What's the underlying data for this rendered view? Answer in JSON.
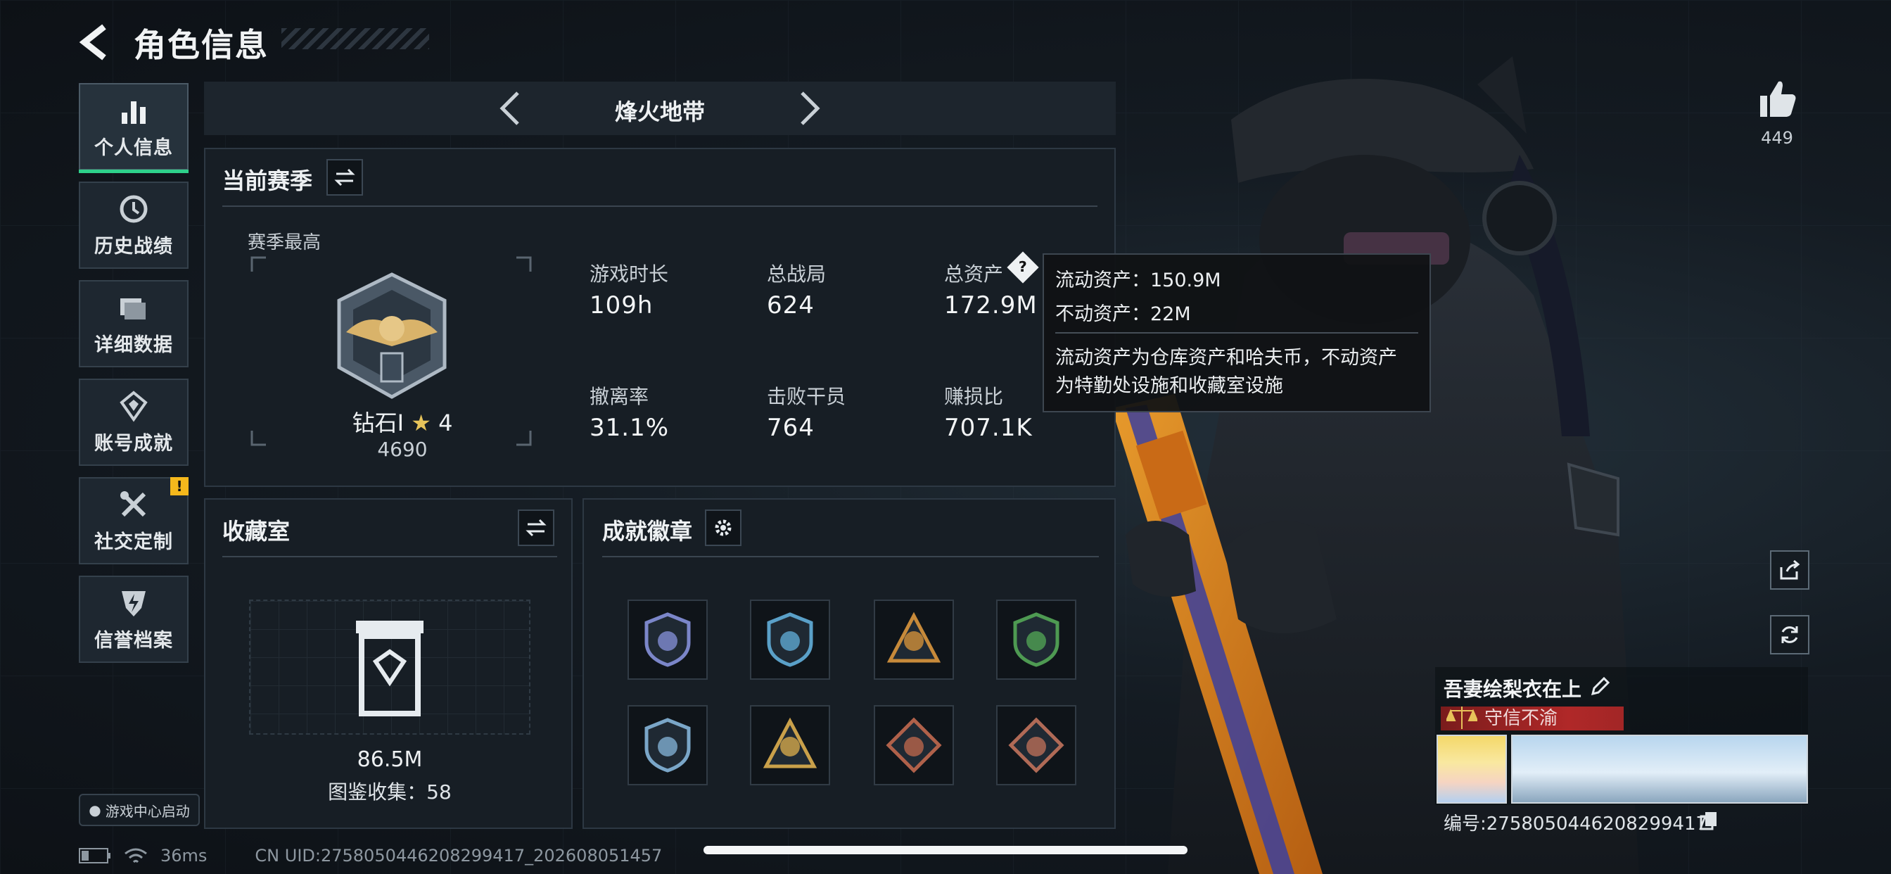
{
  "header": {
    "title": "角色信息"
  },
  "sidebar": {
    "items": [
      {
        "label": "个人信息",
        "icon": "bar-chart-icon",
        "active": true
      },
      {
        "label": "历史战绩",
        "icon": "history-icon"
      },
      {
        "label": "详细数据",
        "icon": "folder-icon"
      },
      {
        "label": "账号成就",
        "icon": "achievement-icon"
      },
      {
        "label": "社交定制",
        "icon": "wrench-icon",
        "badge": "!"
      },
      {
        "label": "信誉档案",
        "icon": "shield-bolt-icon"
      }
    ],
    "game_center": "游戏中心启动"
  },
  "mode": {
    "title": "烽火地带"
  },
  "season": {
    "title": "当前赛季",
    "best_label": "赛季最高",
    "rank_name": "钻石I",
    "rank_stars": "4",
    "rank_score": "4690",
    "stats": [
      {
        "label": "游戏时长",
        "value": "109h"
      },
      {
        "label": "总战局",
        "value": "624"
      },
      {
        "label": "总资产",
        "value": "172.9M"
      },
      {
        "label": "撤离率",
        "value": "31.1%"
      },
      {
        "label": "击败干员",
        "value": "764"
      },
      {
        "label": "赚损比",
        "value": "707.1K"
      }
    ]
  },
  "tooltip": {
    "liquid": "流动资产：150.9M",
    "fixed": "不动资产：22M",
    "desc1": "流动资产为仓库资产和哈夫币，不动资产",
    "desc2": "为特勤处设施和收藏室设施"
  },
  "collection": {
    "title": "收藏室",
    "value": "86.5M",
    "catalog": "图鉴收集：58"
  },
  "badges": {
    "title": "成就徽章",
    "items": [
      {
        "icon": "shield-badge-icon",
        "color": "#7b86c9"
      },
      {
        "icon": "wings-badge-icon",
        "color": "#5aa0c8"
      },
      {
        "icon": "triangle-1-badge-icon",
        "color": "#c78a3a"
      },
      {
        "icon": "target-badge-icon",
        "color": "#4e9a52"
      },
      {
        "icon": "wings-badge-icon",
        "color": "#7aa6c8"
      },
      {
        "icon": "helmet-badge-icon",
        "color": "#c9a04a"
      },
      {
        "icon": "dragon-badge-icon",
        "color": "#b0614a"
      },
      {
        "icon": "runner-badge-icon",
        "color": "#b06a56"
      }
    ]
  },
  "profile": {
    "likes": "449",
    "name": "吾妻绘梨衣在上",
    "honor": "守信不渝",
    "uid": "编号:275805044620829941​7"
  },
  "status": {
    "ping": "36ms",
    "cn_uid": "CN UID:275805044620829941​7_20260805​1457"
  },
  "colors": {
    "accent": "#2ed18b",
    "badge": "#f5b81c",
    "honor": "#b02828"
  }
}
